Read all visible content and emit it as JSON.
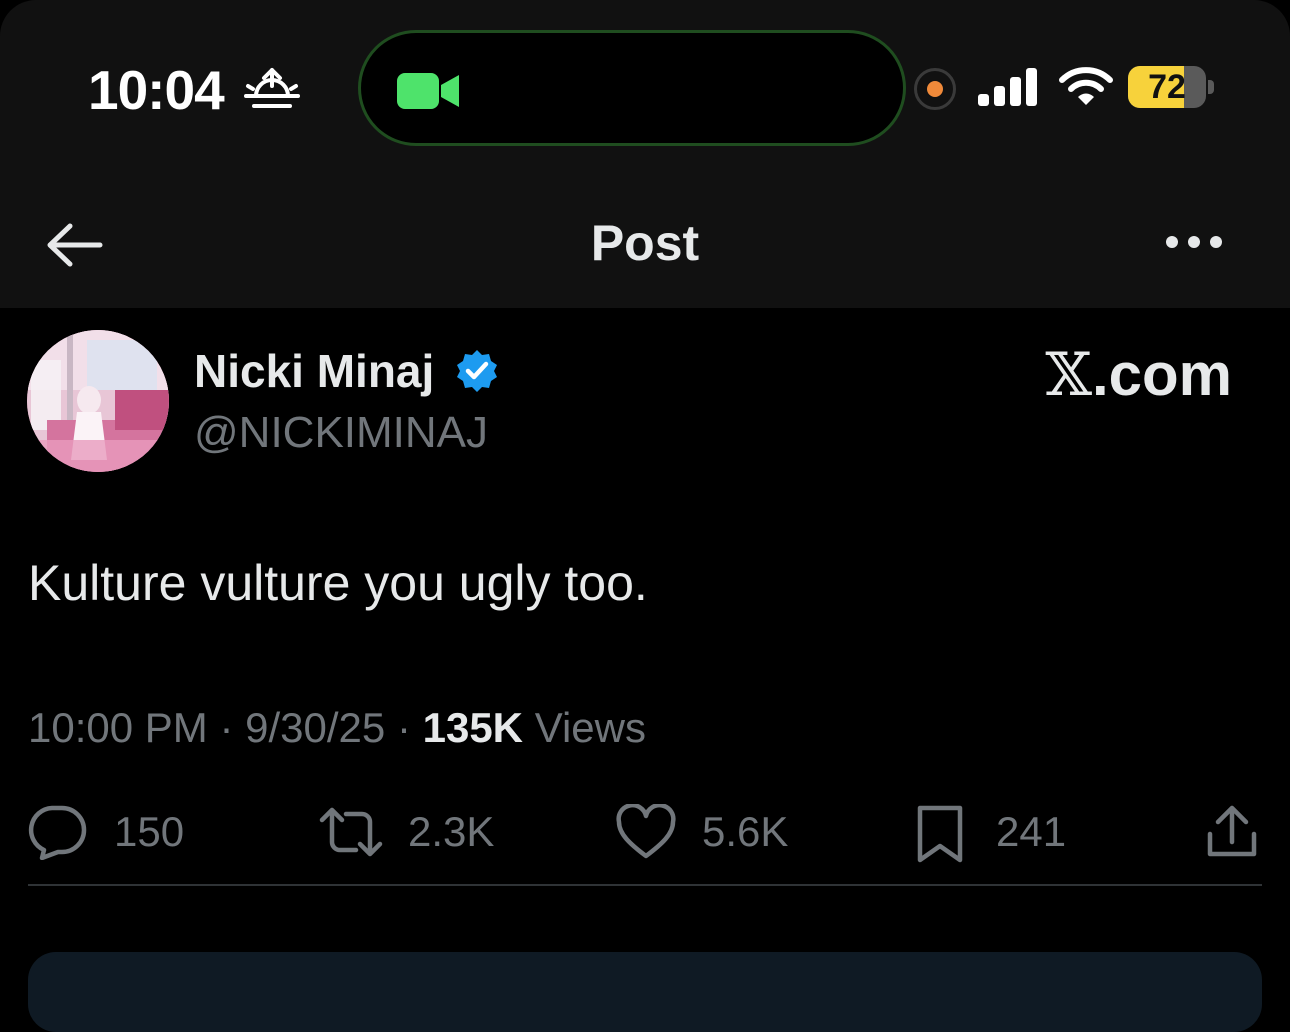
{
  "status_bar": {
    "time": "10:04",
    "battery_level": "72",
    "battery_fraction": 0.72,
    "icons": [
      "sunrise-icon",
      "facetime-camera-icon",
      "recording-indicator-icon",
      "cellular-signal-icon",
      "wifi-icon",
      "battery-icon"
    ]
  },
  "header": {
    "title": "Post",
    "icons": [
      "back-arrow-icon",
      "more-options-icon"
    ]
  },
  "post": {
    "author_name": "Nicki Minaj",
    "author_handle": "@NICKIMINAJ",
    "watermark_x": "𝕏",
    "watermark_domain": ".com",
    "text": "Kulture vulture you ugly too.",
    "time": "10:00 PM",
    "separator": "·",
    "date": "9/30/25",
    "views_count": "135K",
    "views_label": "Views",
    "colors": {
      "verified": "#1d9bf0",
      "text": "#e7e9ea",
      "secondary": "#71767b"
    }
  },
  "actions": {
    "replies": "150",
    "reposts": "2.3K",
    "likes": "5.6K",
    "bookmarks": "241",
    "icons": [
      "reply-icon",
      "repost-icon",
      "like-icon",
      "bookmark-icon",
      "share-icon"
    ]
  }
}
